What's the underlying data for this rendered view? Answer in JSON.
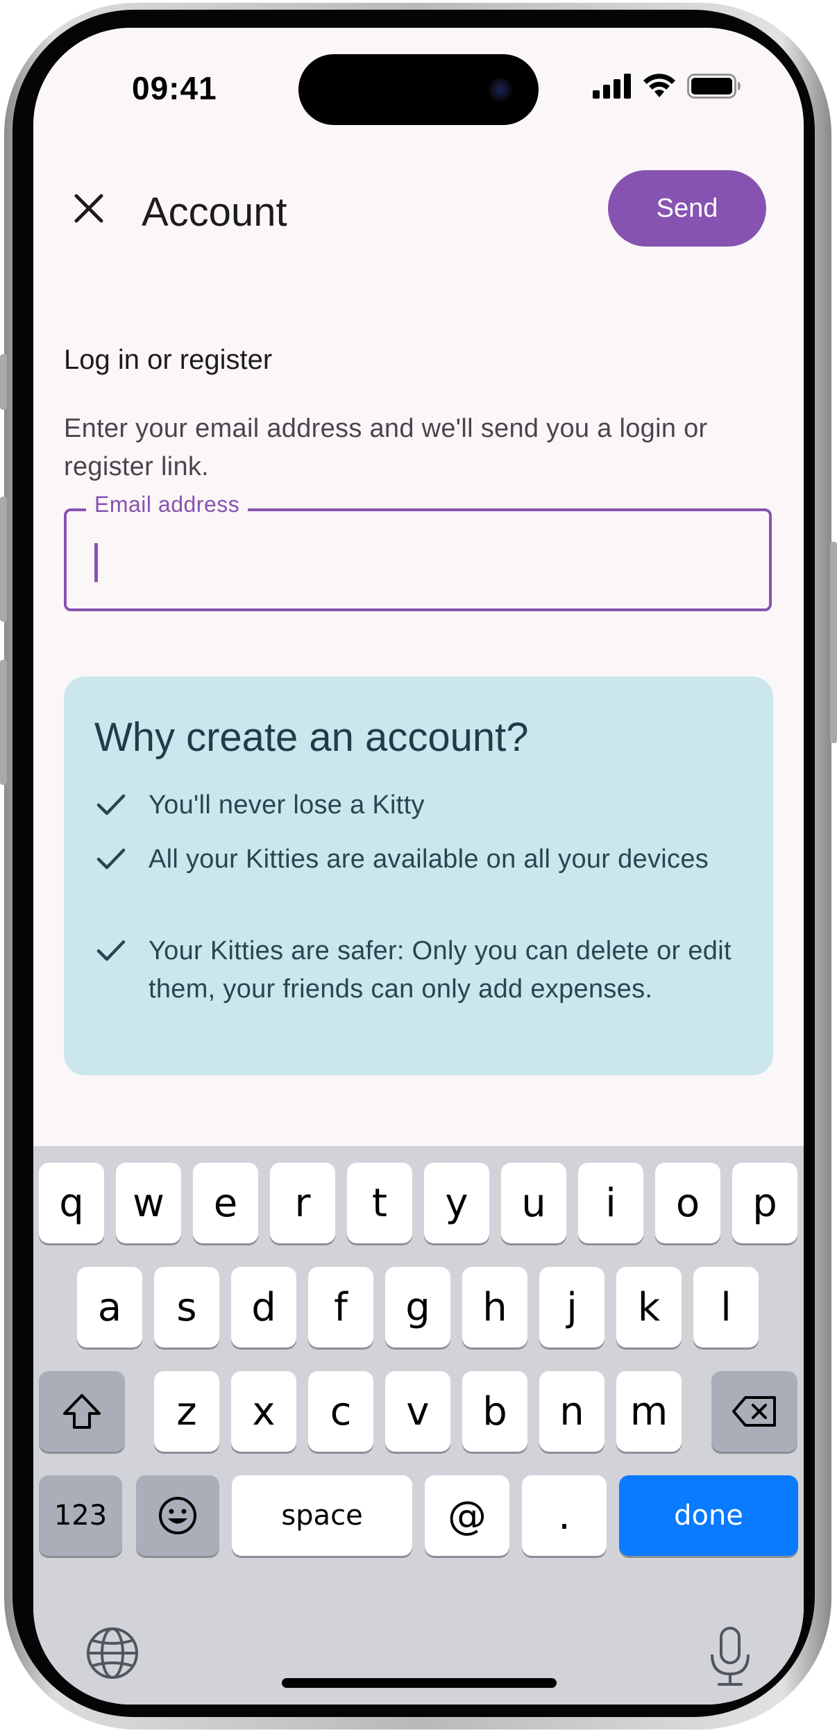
{
  "status_bar": {
    "time": "09:41"
  },
  "header": {
    "title": "Account",
    "send_label": "Send"
  },
  "login": {
    "heading": "Log in or register",
    "description": "Enter your email address and we'll send you a login or register link.",
    "email_label": "Email address",
    "email_value": ""
  },
  "info_card": {
    "title": "Why create an account?",
    "benefits": [
      "You'll never lose a Kitty",
      "All your Kitties are available on all your devices",
      "Your Kitties are safer: Only you can delete or edit them, your friends can only add expenses."
    ]
  },
  "keyboard": {
    "row1": [
      "q",
      "w",
      "e",
      "r",
      "t",
      "y",
      "u",
      "i",
      "o",
      "p"
    ],
    "row2": [
      "a",
      "s",
      "d",
      "f",
      "g",
      "h",
      "j",
      "k",
      "l"
    ],
    "row3": [
      "z",
      "x",
      "c",
      "v",
      "b",
      "n",
      "m"
    ],
    "numbers_label": "123",
    "space_label": "space",
    "at_label": "@",
    "dot_label": ".",
    "done_label": "done"
  },
  "colors": {
    "accent": "#8753b1",
    "card_bg": "#cbe6ec",
    "keyboard_done": "#0a7aff"
  },
  "icons": [
    "close-icon",
    "check-icon",
    "shift-icon",
    "backspace-icon",
    "emoji-icon",
    "globe-icon",
    "microphone-icon",
    "cellular-signal-icon",
    "wifi-icon",
    "battery-icon"
  ]
}
